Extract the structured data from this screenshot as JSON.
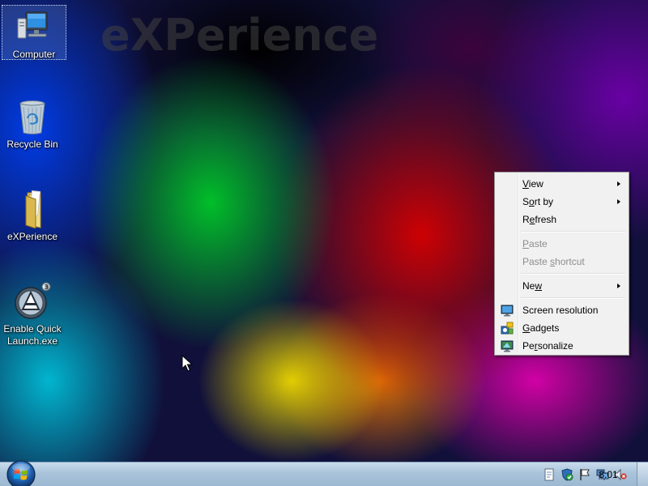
{
  "wallpaper": {
    "watermark_text": "eXPerience"
  },
  "desktop_icons": [
    {
      "label": "Computer",
      "icon": "computer-icon",
      "selected": true
    },
    {
      "label": "Recycle Bin",
      "icon": "recycle-bin-icon"
    },
    {
      "label": "eXPerience",
      "icon": "folder-icon"
    },
    {
      "label": "Enable Quick Launch.exe",
      "icon": "quick-launch-app-icon"
    }
  ],
  "context_menu": {
    "items": [
      {
        "label": "View",
        "accel": "V",
        "submenu": true,
        "enabled": true
      },
      {
        "label": "Sort by",
        "accel": "o",
        "submenu": true,
        "enabled": true
      },
      {
        "label": "Refresh",
        "accel": "e",
        "submenu": false,
        "enabled": true
      },
      {
        "label": "Paste",
        "accel": "P",
        "submenu": false,
        "enabled": false
      },
      {
        "label": "Paste shortcut",
        "accel": "s",
        "submenu": false,
        "enabled": false
      },
      {
        "label": "New",
        "accel": "w",
        "submenu": true,
        "enabled": true
      },
      {
        "label": "Screen resolution",
        "accel": "",
        "submenu": false,
        "enabled": true,
        "icon": "monitor-icon"
      },
      {
        "label": "Gadgets",
        "accel": "G",
        "submenu": false,
        "enabled": true,
        "icon": "gadgets-icon"
      },
      {
        "label": "Personalize",
        "accel": "r",
        "submenu": false,
        "enabled": true,
        "icon": "personalize-icon"
      }
    ]
  },
  "taskbar": {
    "start_button": "start-orb-icon",
    "tray_icons": [
      "action-center-flag-icon",
      "network-icon",
      "volume-muted-icon",
      "security-shield-icon",
      "document-icon"
    ],
    "clock": "8:01"
  },
  "colors": {
    "menu_background": "#f1f1f1",
    "menu_disabled_text": "#8d8d8d",
    "taskbar_top": "#c9dcec",
    "taskbar_bottom": "#9cb8d2"
  }
}
